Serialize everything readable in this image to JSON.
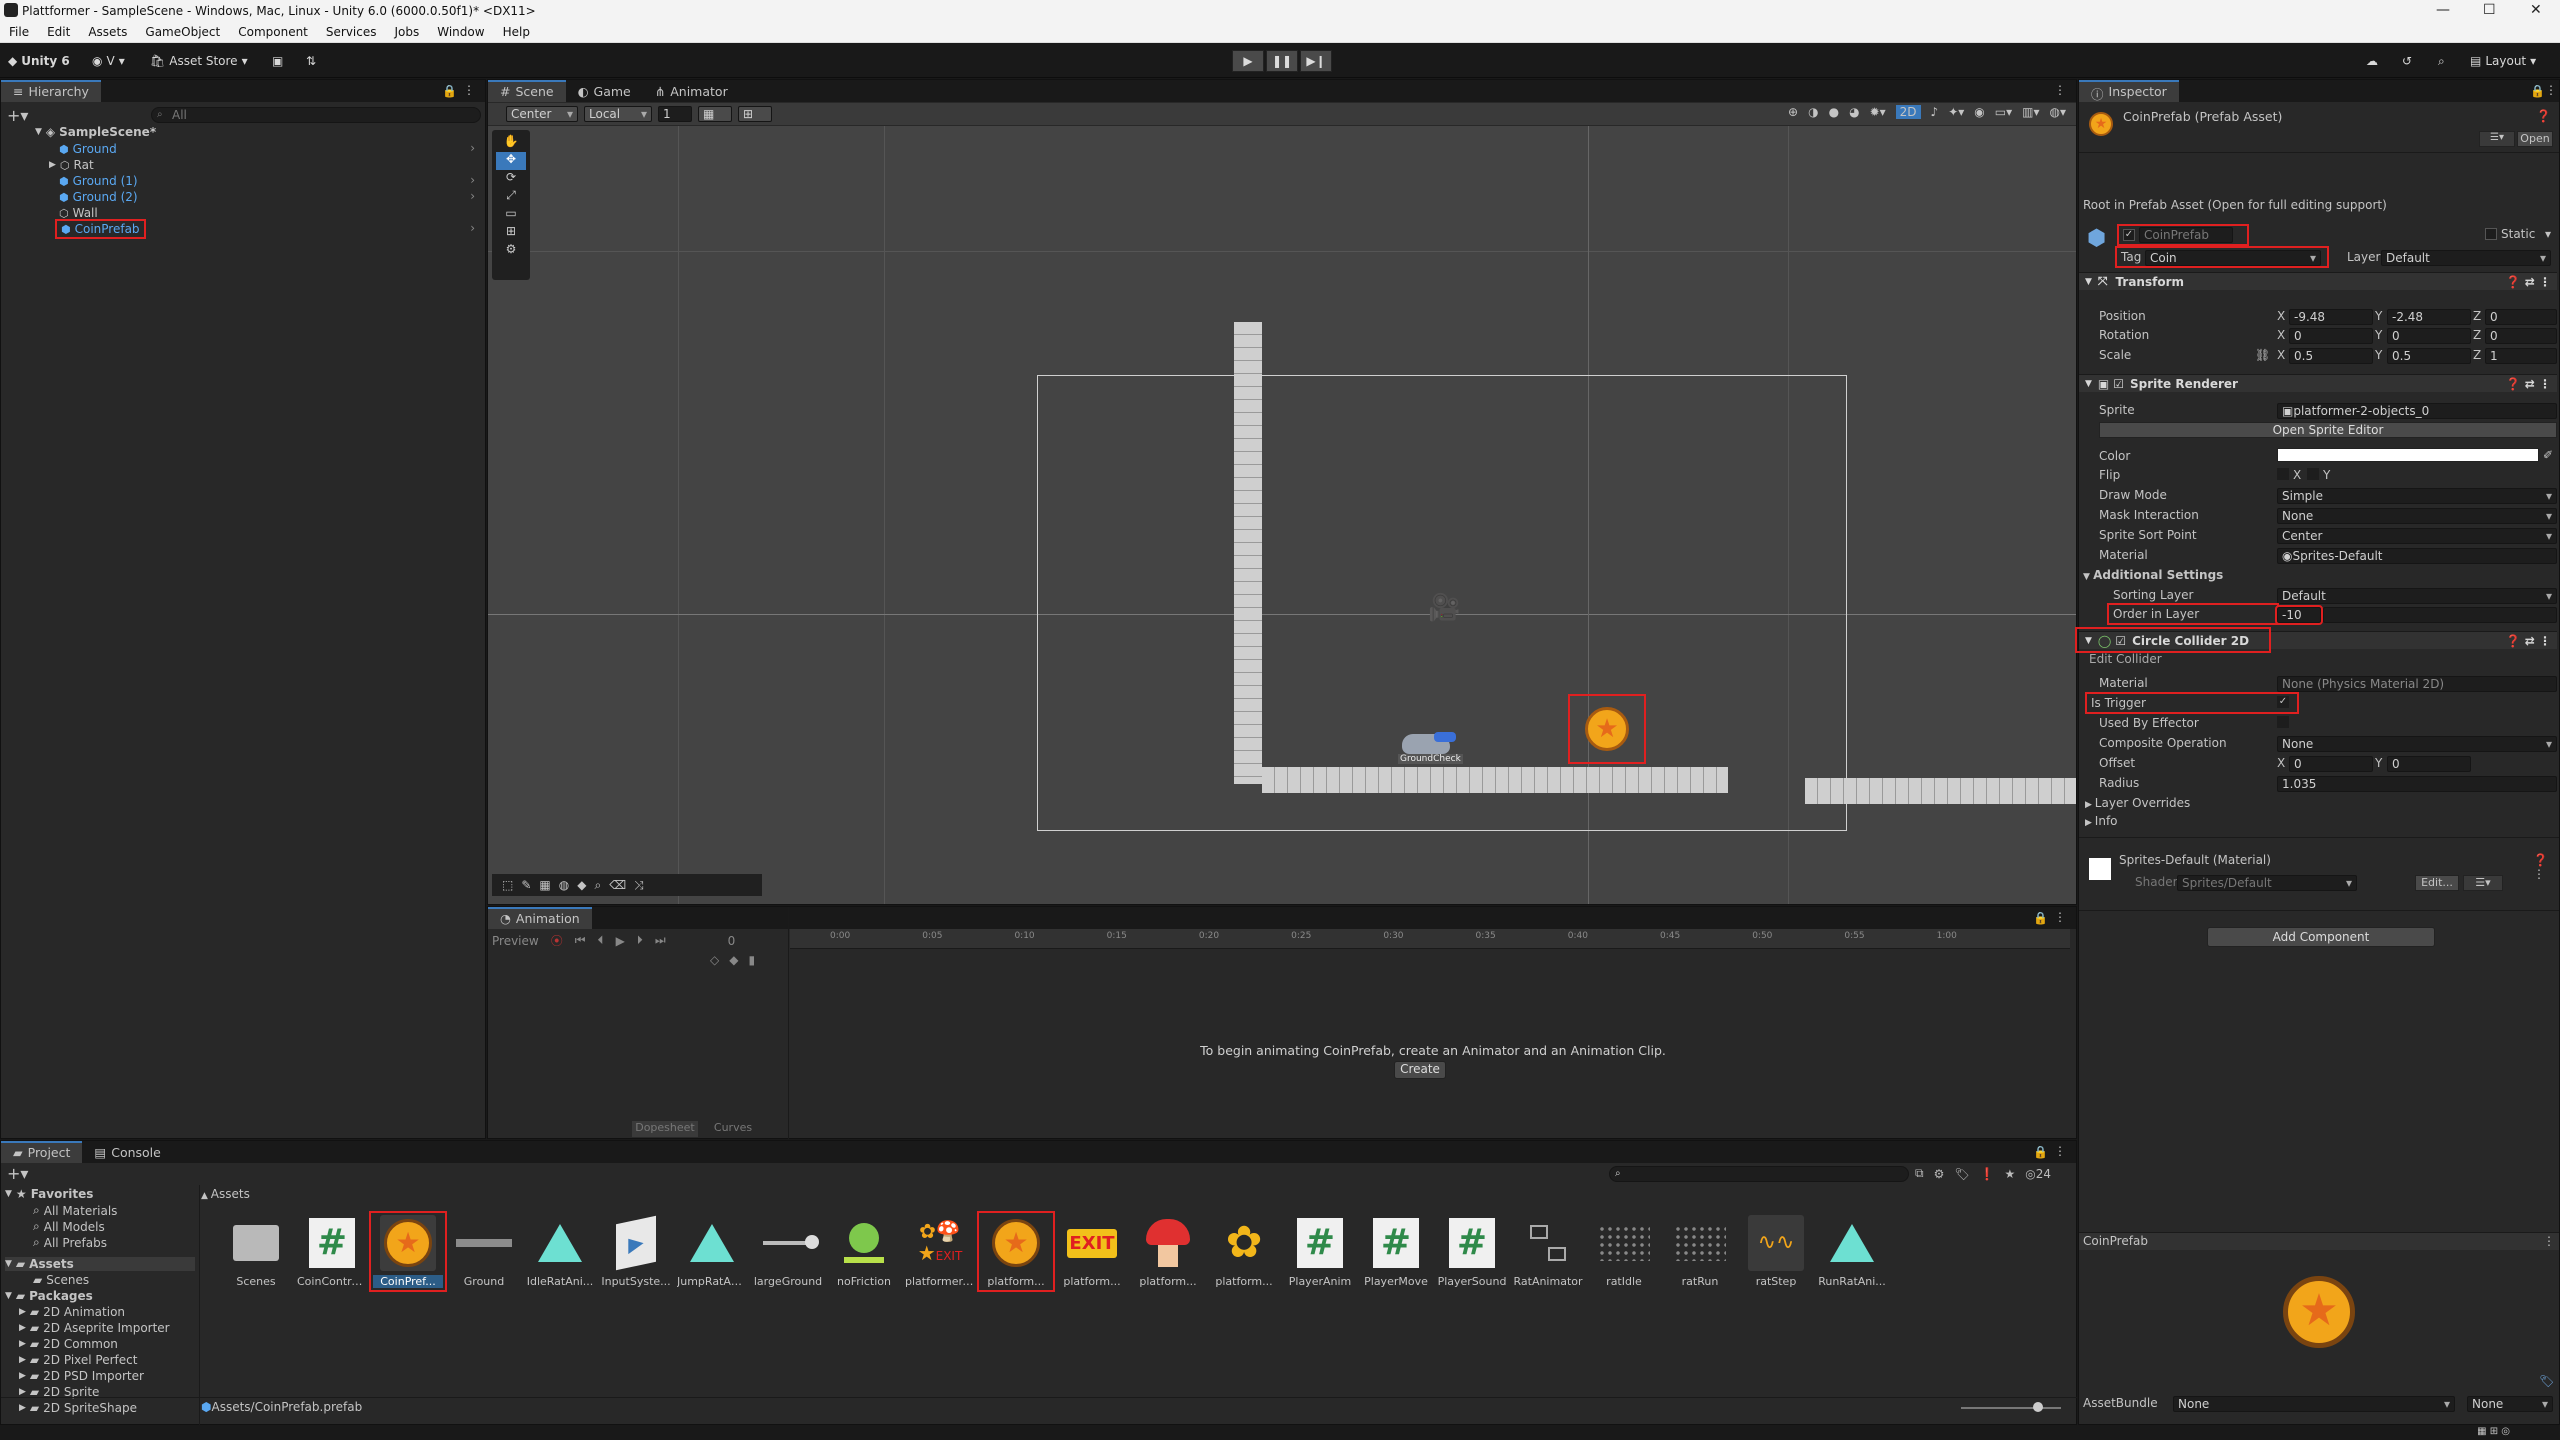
{
  "window": {
    "title": "Plattformer - SampleScene - Windows, Mac, Linux - Unity 6.0 (6000.0.50f1)* <DX11>"
  },
  "menu": [
    "File",
    "Edit",
    "Assets",
    "GameObject",
    "Component",
    "Services",
    "Jobs",
    "Window",
    "Help"
  ],
  "toolbar": {
    "unity_label": "Unity 6",
    "account": "V",
    "asset_store": "Asset Store",
    "layout": "Layout"
  },
  "hierarchy": {
    "tab": "Hierarchy",
    "search_placeholder": "All",
    "scene": "SampleScene*",
    "items": [
      {
        "label": "Ground",
        "prefab": true
      },
      {
        "label": "Rat",
        "prefab": false
      },
      {
        "label": "Ground (1)",
        "prefab": true
      },
      {
        "label": "Ground (2)",
        "prefab": true
      },
      {
        "label": "Wall",
        "prefab": false
      },
      {
        "label": "CoinPrefab",
        "prefab": true
      }
    ]
  },
  "scene": {
    "tabs": [
      "Scene",
      "Game",
      "Animator"
    ],
    "pivot": "Center",
    "space": "Local",
    "grid_snap": "1",
    "mode_2d": "2D",
    "rat_label": "GroundCheck"
  },
  "animation": {
    "tab": "Animation",
    "preview": "Preview",
    "frame": "0",
    "ticks": [
      "0:00",
      "0:05",
      "0:10",
      "0:15",
      "0:20",
      "0:25",
      "0:30",
      "0:35",
      "0:40",
      "0:45",
      "0:50",
      "0:55",
      "1:00"
    ],
    "message": "To begin animating CoinPrefab, create an Animator and an Animation Clip.",
    "create": "Create",
    "dopesheet": "Dopesheet",
    "curves": "Curves"
  },
  "inspector": {
    "tab": "Inspector",
    "asset_title": "CoinPrefab (Prefab Asset)",
    "open": "Open",
    "root_note": "Root in Prefab Asset (Open for full editing support)",
    "name": "CoinPrefab",
    "static": "Static",
    "tag_label": "Tag",
    "tag": "Coin",
    "layer_label": "Layer",
    "layer": "Default",
    "transform": {
      "title": "Transform",
      "position": {
        "label": "Position",
        "x": "-9.48",
        "y": "-2.48",
        "z": "0"
      },
      "rotation": {
        "label": "Rotation",
        "x": "0",
        "y": "0",
        "z": "0"
      },
      "scale": {
        "label": "Scale",
        "x": "0.5",
        "y": "0.5",
        "z": "1"
      }
    },
    "sprite_renderer": {
      "title": "Sprite Renderer",
      "sprite_label": "Sprite",
      "sprite": "platformer-2-objects_0",
      "open_editor": "Open Sprite Editor",
      "color_label": "Color",
      "flip_label": "Flip",
      "flip_x": "X",
      "flip_y": "Y",
      "draw_mode_label": "Draw Mode",
      "draw_mode": "Simple",
      "mask_label": "Mask Interaction",
      "mask": "None",
      "sort_point_label": "Sprite Sort Point",
      "sort_point": "Center",
      "material_label": "Material",
      "material": "Sprites-Default",
      "additional": "Additional Settings",
      "sorting_layer_label": "Sorting Layer",
      "sorting_layer": "Default",
      "order_label": "Order in Layer",
      "order": "-10"
    },
    "collider": {
      "title": "Circle Collider 2D",
      "edit": "Edit Collider",
      "material_label": "Material",
      "material": "None (Physics Material 2D)",
      "trigger_label": "Is Trigger",
      "effector_label": "Used By Effector",
      "composite_label": "Composite Operation",
      "composite": "None",
      "offset_label": "Offset",
      "offset_x": "0",
      "offset_y": "0",
      "radius_label": "Radius",
      "radius": "1.035",
      "layer_overrides": "Layer Overrides",
      "info": "Info"
    },
    "material_block": {
      "name": "Sprites-Default (Material)",
      "shader_label": "Shader",
      "shader": "Sprites/Default",
      "edit": "Edit..."
    },
    "add_component": "Add Component",
    "preview_title": "CoinPrefab",
    "assetbundle_label": "AssetBundle",
    "assetbundle": "None",
    "variant": "None"
  },
  "project": {
    "tabs": [
      "Project",
      "Console"
    ],
    "favorites": "Favorites",
    "fav_items": [
      "All Materials",
      "All Models",
      "All Prefabs"
    ],
    "assets_root": "Assets",
    "assets_children": [
      "Scenes"
    ],
    "packages": "Packages",
    "package_items": [
      "2D Animation",
      "2D Aseprite Importer",
      "2D Common",
      "2D Pixel Perfect",
      "2D PSD Importer",
      "2D Sprite",
      "2D SpriteShape"
    ],
    "breadcrumb": "Assets",
    "count": "24",
    "status_path": "Assets/CoinPrefab.prefab",
    "items": [
      {
        "label": "Scenes",
        "icon": "folder-icon"
      },
      {
        "label": "CoinContro...",
        "icon": "script-icon"
      },
      {
        "label": "CoinPref...",
        "icon": "coin-prefab-icon"
      },
      {
        "label": "Ground",
        "icon": "ground-prefab-icon"
      },
      {
        "label": "IdleRatAni...",
        "icon": "animation-clip-icon"
      },
      {
        "label": "InputSyste...",
        "icon": "input-actions-icon"
      },
      {
        "label": "JumpRatAn...",
        "icon": "animation-clip-icon"
      },
      {
        "label": "largeGround",
        "icon": "sprite-icon"
      },
      {
        "label": "noFriction",
        "icon": "physics-material-icon"
      },
      {
        "label": "platformer-...",
        "icon": "spritesheet-icon"
      },
      {
        "label": "platform...",
        "icon": "coin-sprite-icon"
      },
      {
        "label": "platform...",
        "icon": "exit-sprite-icon"
      },
      {
        "label": "platform...",
        "icon": "mushroom-sprite-icon"
      },
      {
        "label": "platform...",
        "icon": "flower-sprite-icon"
      },
      {
        "label": "PlayerAnim",
        "icon": "script-icon"
      },
      {
        "label": "PlayerMove",
        "icon": "script-icon"
      },
      {
        "label": "PlayerSound",
        "icon": "script-icon"
      },
      {
        "label": "RatAnimator",
        "icon": "animator-icon"
      },
      {
        "label": "ratIdle",
        "icon": "sprite-anim-icon"
      },
      {
        "label": "ratRun",
        "icon": "sprite-anim-icon"
      },
      {
        "label": "ratStep",
        "icon": "audio-icon"
      },
      {
        "label": "RunRatAni...",
        "icon": "animation-clip-icon"
      }
    ]
  },
  "colors": {
    "accent": "#3a79bb",
    "highlight": "#e02020",
    "coin": "#f2a51a",
    "prefab_blue": "#5aa8f2"
  }
}
